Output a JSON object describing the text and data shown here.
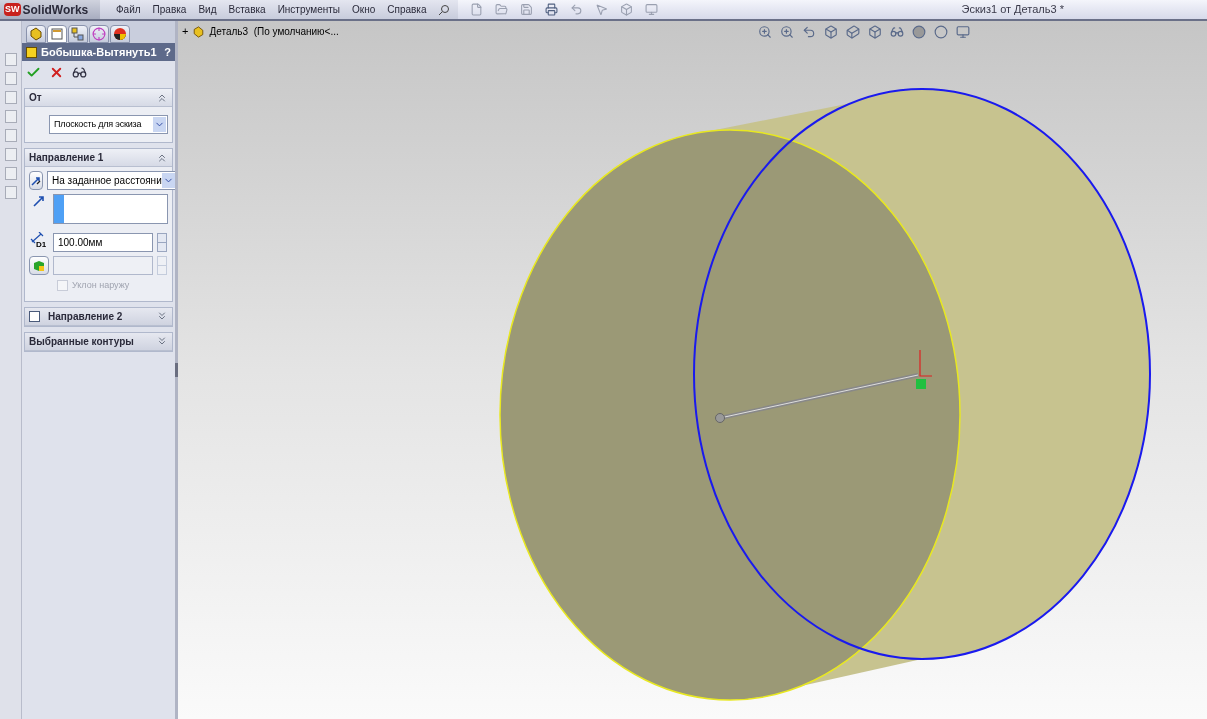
{
  "app": {
    "logo_badge": "SW",
    "logo_text": "SolidWorks"
  },
  "menu": [
    "Файл",
    "Правка",
    "Вид",
    "Вставка",
    "Инструменты",
    "Окно",
    "Справка"
  ],
  "window": {
    "title": "Эскиз1 от Деталь3 *"
  },
  "panel_tabs": [
    {
      "kind": "tree",
      "selected": false
    },
    {
      "kind": "property",
      "selected": true
    },
    {
      "kind": "config",
      "selected": false
    },
    {
      "kind": "dim",
      "selected": false
    },
    {
      "kind": "display",
      "selected": false
    }
  ],
  "feature": {
    "title": "Бобышка-Вытянуть1",
    "help": "?"
  },
  "sections": [
    {
      "kind": "from",
      "title": "От",
      "expanded": true,
      "value": "Плоскость для эскиза"
    },
    {
      "kind": "direction",
      "title": "Направление 1",
      "expanded": true,
      "end_condition": "На заданное расстояни",
      "depth": "100.00мм",
      "depth_symbol": "D1",
      "draft": {
        "label": "Уклон наружу",
        "checked": false,
        "disabled": true
      }
    },
    {
      "kind": "optional",
      "title": "Направление 2",
      "expanded": false,
      "checked": false
    },
    {
      "kind": "plain",
      "title": "Выбранные контуры",
      "expanded": false
    }
  ],
  "tree": {
    "expander": "+",
    "label": "Деталь3  (По умолчанию<..."
  }
}
